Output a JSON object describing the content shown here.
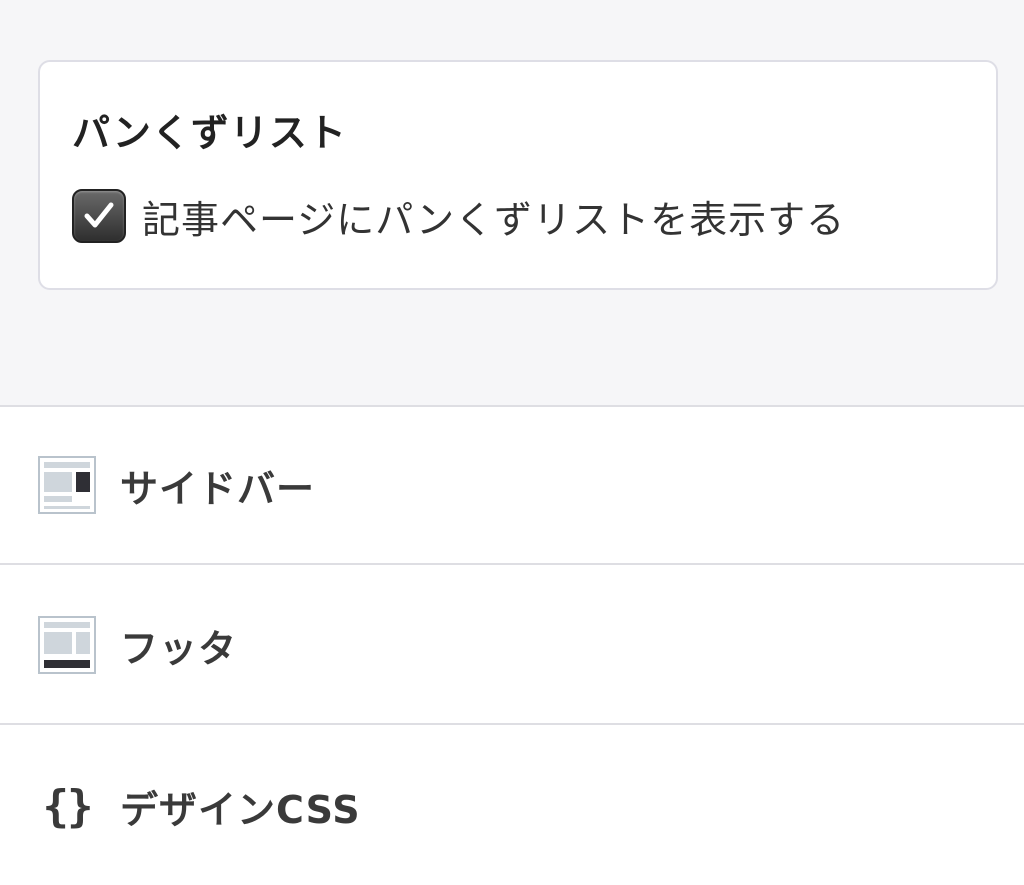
{
  "breadcrumb_section": {
    "title": "パンくずリスト",
    "checkbox": {
      "label": "記事ページにパンくずリストを表示する",
      "checked": true
    }
  },
  "nav_items": [
    {
      "label": "サイドバー",
      "icon": "sidebar-layout-icon"
    },
    {
      "label": "フッタ",
      "icon": "footer-layout-icon"
    },
    {
      "label": "デザインCSS",
      "icon": "curly-braces-icon",
      "icon_text": "{}"
    }
  ],
  "colors": {
    "panel_bg": "#f6f6f8",
    "border": "#dedee3",
    "text": "#3a3a3a",
    "checkbox_fill": "#3c3c3c"
  }
}
